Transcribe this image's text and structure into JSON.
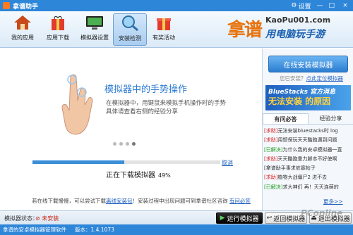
{
  "window": {
    "title": "拿谱助手",
    "settings_label": "设置",
    "min_label": "—",
    "max_label": "□",
    "close_label": "×"
  },
  "toolbar": {
    "items": [
      {
        "label": "我的应用",
        "icon": "house-icon"
      },
      {
        "label": "应用下载",
        "icon": "gift-bag-icon"
      },
      {
        "label": "模拟器设置",
        "icon": "monitor-icon"
      },
      {
        "label": "安装检测",
        "icon": "magnifier-icon",
        "active": true
      },
      {
        "label": "有奖活动",
        "icon": "gift-box-icon"
      }
    ]
  },
  "logo": {
    "brand": "拿谱",
    "domain": "KaoPu001.com",
    "slogan": "用电脑玩手游"
  },
  "main": {
    "gesture_title": "模拟器中的手势操作",
    "gesture_desc": "在模拟器中，用键鼠来模拟手机操作时的手势具体请查看右侧的经验分享",
    "progress_pct": 49,
    "progress_label": "正在下载模拟器",
    "progress_value": "49%",
    "cancel_label": "取消",
    "hint_prefix": "若在线下载慢慢，可以尝试下载",
    "hint_link1": "离线安装包",
    "hint_middle": "！安装过程中出现问题可到拿谱社区咨询",
    "hint_link2": "有问必答"
  },
  "sidebar": {
    "install_button": "在线安装模拟器",
    "installed_note_prefix": "您已安装？",
    "installed_note_link": "点此定位模拟器",
    "banner_line1": "BlueStacks 官方消息",
    "banner_line2": "无法安装 的原因",
    "tabs": [
      "有问必答",
      "经验分享"
    ],
    "news": [
      {
        "tag": "[求助]",
        "tag_type": "help",
        "text": "无法安装bluestacks时 log"
      },
      {
        "tag": "[求助]",
        "tag_type": "help",
        "text": "用惯保玩天天酷跑遇到问题"
      },
      {
        "tag": "[已解决]",
        "tag_type": "solved",
        "text": "为什么我的安卓模拟器一直"
      },
      {
        "tag": "[求助]",
        "tag_type": "help",
        "text": "天天酷跑重力脚本不好使啊"
      },
      {
        "tag": "",
        "tag_type": "none",
        "text": "[拿谱助手事求依寡帖子"
      },
      {
        "tag": "[求助]",
        "tag_type": "help",
        "text": "植物大战僵尸2 进不去"
      },
      {
        "tag": "[已解决]",
        "tag_type": "solved",
        "text": "求大神们 再！天天连萌的"
      }
    ],
    "more_label": "更多>>"
  },
  "bottom": {
    "sim_label": "模拟器状态：",
    "sim_status": "未安装",
    "run_button": "运行模拟器",
    "back_button": "返回模拟器",
    "exit_button": "退出模拟器"
  },
  "footer": {
    "left": "拿谱的安卓模拟器管理软件",
    "version": "版本：1.4.1073"
  },
  "watermark": "PConline"
}
